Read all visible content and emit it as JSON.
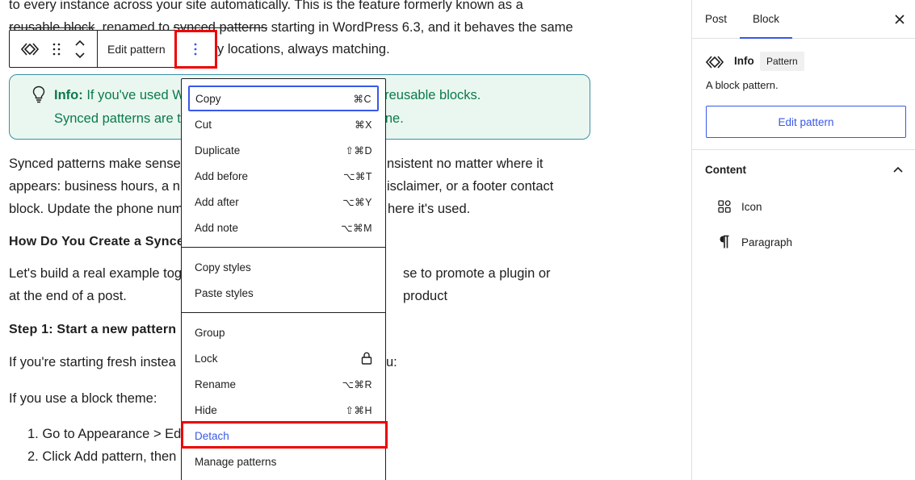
{
  "content": {
    "para1_line1": "to every instance across your site automatically. This is the feature formerly known as a",
    "para1_line2_a": "reusable block",
    "para1_line2_b": ", renamed to ",
    "para1_line2_c": "synced patterns",
    "para1_line2_d": " starting in WordPress 6.3, and it behaves the same",
    "para1_line3_tail": "y locations, always matching.",
    "info_label": "Info:",
    "info_line1_a": " If you've used W",
    "info_line1_b": "ember reusable blocks.",
    "info_line2_a": "Synced patterns are t",
    "info_line2_b": "ne.",
    "para2_line1_a": "Synced patterns make sense",
    "para2_line1_b": "nsistent no matter where it",
    "para2_line2_a": "appears: business hours, a n",
    "para2_line2_b": "isclaimer, or a footer contact",
    "para2_line3_a": "block. Update the phone num",
    "para2_line3_b": "here it's used.",
    "heading1": "How Do You Create a Synce",
    "para3_line1_a": "Let's build a real example tog",
    "para3_line1_b": "se to promote a plugin or product",
    "para3_line2": "at the end of a post.",
    "heading2": "Step 1: Start a new pattern",
    "para4_a": "If you're starting fresh instea",
    "para4_b": "u:",
    "para5": "If you use a block theme:",
    "list1": "1. Go to Appearance > Ed",
    "list2": "2. Click Add pattern, then"
  },
  "toolbar": {
    "edit_label": "Edit pattern",
    "more_icon": "vertical-ellipsis-icon"
  },
  "menu": {
    "group1": [
      {
        "label": "Copy",
        "shortcut": "⌘C"
      },
      {
        "label": "Cut",
        "shortcut": "⌘X"
      },
      {
        "label": "Duplicate",
        "shortcut": "⇧⌘D"
      },
      {
        "label": "Add before",
        "shortcut": "⌥⌘T"
      },
      {
        "label": "Add after",
        "shortcut": "⌥⌘Y"
      },
      {
        "label": "Add note",
        "shortcut": "⌥⌘M"
      }
    ],
    "group2": [
      {
        "label": "Copy styles"
      },
      {
        "label": "Paste styles"
      }
    ],
    "group3": [
      {
        "label": "Group",
        "shortcut": ""
      },
      {
        "label": "Lock",
        "shortcut": ""
      },
      {
        "label": "Rename",
        "shortcut": "⌥⌘R"
      },
      {
        "label": "Hide",
        "shortcut": "⇧⌘H"
      },
      {
        "label": "Detach",
        "shortcut": ""
      },
      {
        "label": "Manage patterns",
        "shortcut": ""
      }
    ]
  },
  "sidebar": {
    "tab_post": "Post",
    "tab_block": "Block",
    "block_title": "Info",
    "block_badge": "Pattern",
    "block_desc": "A block pattern.",
    "edit_button": "Edit pattern",
    "content_heading": "Content",
    "content_items": [
      {
        "label": "Icon",
        "icon": "shapes-icon"
      },
      {
        "label": "Paragraph",
        "icon": "pilcrow-icon"
      }
    ]
  },
  "colors": {
    "accent": "#3858e9",
    "highlight": "#e00000",
    "info_text": "#0b7a4b",
    "info_bg": "#eaf7f1",
    "info_border": "#3a8fa3"
  }
}
